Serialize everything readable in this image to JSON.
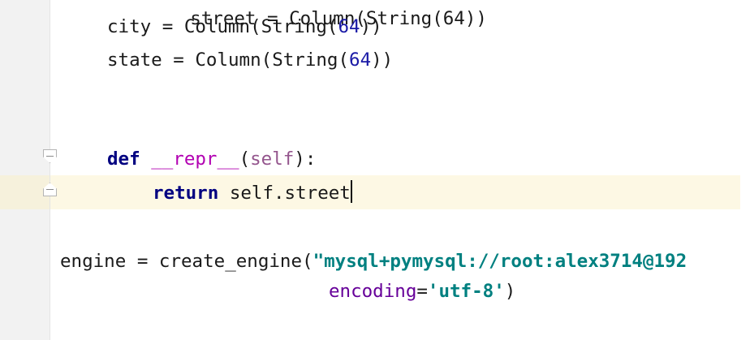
{
  "editor": {
    "top_partial_line": "street = Column(String(64))",
    "lines": {
      "city": {
        "name": "city",
        "eq": " = ",
        "call_open": "Column(String(",
        "num": "64",
        "call_close": "))"
      },
      "state": {
        "name": "state",
        "eq": " = ",
        "call_open": "Column(String(",
        "num": "64",
        "call_close": "))"
      },
      "def_line": {
        "keyword": "def",
        "sp": " ",
        "fname": "__repr__",
        "paren_open": "(",
        "param": "self",
        "paren_close": "):"
      },
      "return_line": {
        "keyword": "return",
        "sp": " ",
        "expr": "self.street"
      },
      "engine_line": {
        "prefix": "engine = create_engine(",
        "string": "\"mysql+pymysql://root:alex3714@192"
      },
      "encoding_line": {
        "kwarg": "encoding",
        "eq": "=",
        "string": "'utf-8'",
        "close": ")"
      }
    },
    "colors": {
      "keyword": "#000080",
      "number": "#1a1aa6",
      "magic_method": "#b200b2",
      "self_param": "#94558d",
      "string": "#008080",
      "kwarg": "#660099",
      "current_line_bg": "#fdf8e4"
    }
  }
}
